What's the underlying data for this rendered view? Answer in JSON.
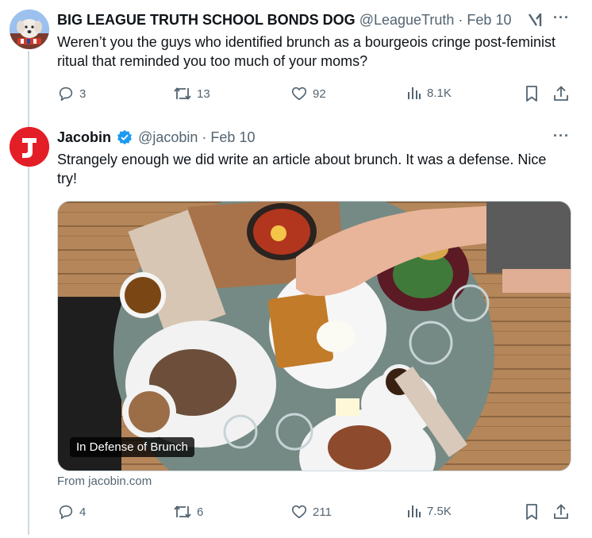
{
  "tweet1": {
    "display_name": "BIG LEAGUE TRUTH SCHOOL BONDS DOG",
    "handle": "@LeagueTruth",
    "separator": "·",
    "date": "Feb 10",
    "text": "Weren’t you the guys who identified brunch as a bourgeois cringe post-feminist ritual that reminded you too much of your moms?",
    "more": "···",
    "replies": "3",
    "retweets": "13",
    "likes": "92",
    "views": "8.1K"
  },
  "tweet2": {
    "display_name": "Jacobin",
    "handle": "@jacobin",
    "separator": "·",
    "date": "Feb 10",
    "text": "Strangely enough we did write an article about brunch. It was a defense. Nice try!",
    "more": "···",
    "card_title": "In Defense of Brunch",
    "card_source": "From jacobin.com",
    "replies": "4",
    "retweets": "6",
    "likes": "211",
    "views": "7.5K"
  },
  "colors": {
    "text_primary": "#0f1419",
    "text_secondary": "#536471",
    "verified": "#1d9bf0",
    "jacobin_red": "#e41e26",
    "thread_line": "#cfd9de"
  }
}
